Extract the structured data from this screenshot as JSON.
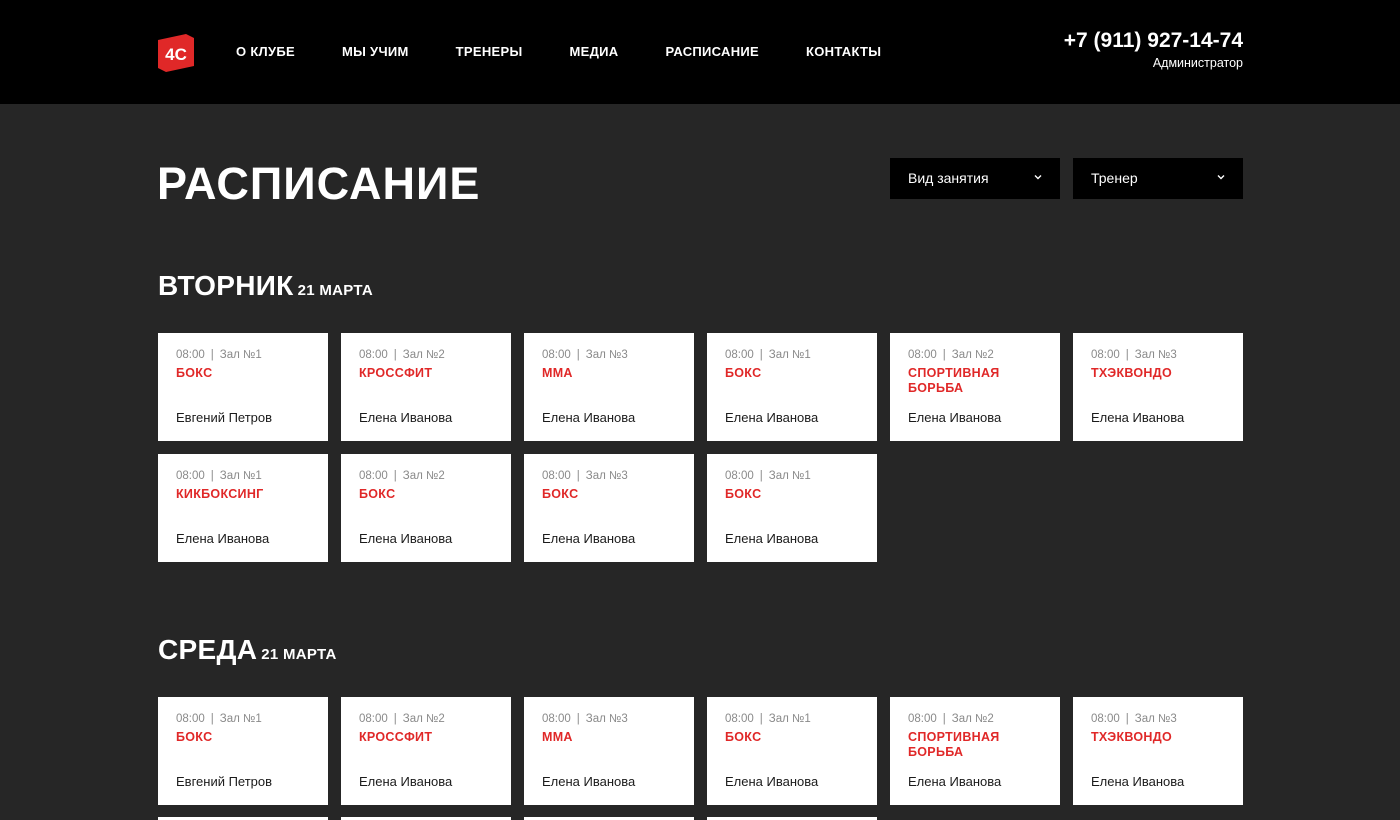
{
  "header": {
    "logo_text": "4С",
    "nav": [
      "О КЛУБЕ",
      "МЫ УЧИМ",
      "ТРЕНЕРЫ",
      "МЕДИА",
      "РАСПИСАНИЕ",
      "КОНТАКТЫ"
    ],
    "phone": "+7 (911) 927-14-74",
    "phone_role": "Администратор"
  },
  "page": {
    "title": "РАСПИСАНИЕ",
    "filters": {
      "type_label": "Вид занятия",
      "trainer_label": "Тренер"
    }
  },
  "schedule": [
    {
      "day": "ВТОРНИК",
      "date": "21 МАРТА",
      "classes": [
        {
          "time": "08:00",
          "hall": "Зал №1",
          "name": "БОКС",
          "trainer": "Евгений Петров"
        },
        {
          "time": "08:00",
          "hall": "Зал №2",
          "name": "КРОССФИТ",
          "trainer": "Елена Иванова"
        },
        {
          "time": "08:00",
          "hall": "Зал №3",
          "name": "ММА",
          "trainer": "Елена Иванова"
        },
        {
          "time": "08:00",
          "hall": "Зал №1",
          "name": "БОКС",
          "trainer": "Елена Иванова"
        },
        {
          "time": "08:00",
          "hall": "Зал №2",
          "name": "СПОРТИВНАЯ БОРЬБА",
          "trainer": "Елена Иванова"
        },
        {
          "time": "08:00",
          "hall": "Зал №3",
          "name": "ТХЭКВОНДО",
          "trainer": "Елена Иванова"
        },
        {
          "time": "08:00",
          "hall": "Зал №1",
          "name": "КИКБОКСИНГ",
          "trainer": "Елена Иванова"
        },
        {
          "time": "08:00",
          "hall": "Зал №2",
          "name": "БОКС",
          "trainer": "Елена Иванова"
        },
        {
          "time": "08:00",
          "hall": "Зал №3",
          "name": "БОКС",
          "trainer": "Елена Иванова"
        },
        {
          "time": "08:00",
          "hall": "Зал №1",
          "name": "БОКС",
          "trainer": "Елена Иванова"
        }
      ]
    },
    {
      "day": "СРЕДА",
      "date": "21 МАРТА",
      "classes": [
        {
          "time": "08:00",
          "hall": "Зал №1",
          "name": "БОКС",
          "trainer": "Евгений Петров"
        },
        {
          "time": "08:00",
          "hall": "Зал №2",
          "name": "КРОССФИТ",
          "trainer": "Елена Иванова"
        },
        {
          "time": "08:00",
          "hall": "Зал №3",
          "name": "ММА",
          "trainer": "Елена Иванова"
        },
        {
          "time": "08:00",
          "hall": "Зал №1",
          "name": "БОКС",
          "trainer": "Елена Иванова"
        },
        {
          "time": "08:00",
          "hall": "Зал №2",
          "name": "СПОРТИВНАЯ БОРЬБА",
          "trainer": "Елена Иванова"
        },
        {
          "time": "08:00",
          "hall": "Зал №3",
          "name": "ТХЭКВОНДО",
          "trainer": "Елена Иванова"
        }
      ]
    }
  ],
  "colors": {
    "accent": "#e02828",
    "background": "#262626",
    "header": "#000000",
    "card": "#ffffff"
  }
}
